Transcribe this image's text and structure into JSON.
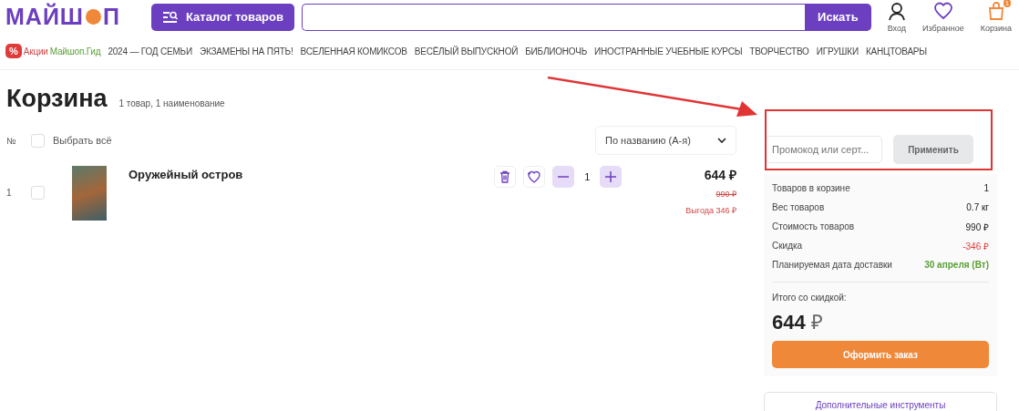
{
  "header": {
    "logo_start": "МАЙШ",
    "logo_end": "П",
    "catalog_button": "Каталог товаров",
    "search_button": "Искать",
    "actions": [
      {
        "kind": "user",
        "label": "Вход"
      },
      {
        "kind": "heart",
        "label": "Избранное"
      },
      {
        "kind": "cart",
        "label": "Корзина",
        "badge": "1"
      }
    ]
  },
  "nav": {
    "promo_icon": "%",
    "items": [
      {
        "kind": "sale",
        "label": "Акции"
      },
      {
        "kind": "guide",
        "label": "Майшоп.Гид"
      },
      {
        "kind": "plain",
        "label": "2024 — ГОД СЕМЬИ"
      },
      {
        "kind": "plain",
        "label": "ЭКЗАМЕНЫ НА ПЯТЬ!"
      },
      {
        "kind": "plain",
        "label": "ВСЕЛЕННАЯ КОМИКСОВ"
      },
      {
        "kind": "plain",
        "label": "ВЕСЁЛЫЙ ВЫПУСКНОЙ"
      },
      {
        "kind": "plain",
        "label": "БИБЛИОНОЧЬ"
      },
      {
        "kind": "plain",
        "label": "ИНОСТРАННЫЕ УЧЕБНЫЕ КУРСЫ"
      },
      {
        "kind": "plain",
        "label": "ТВОРЧЕСТВО"
      },
      {
        "kind": "plain",
        "label": "ИГРУШКИ"
      },
      {
        "kind": "plain",
        "label": "КАНЦТОВАРЫ"
      }
    ]
  },
  "cart": {
    "title": "Корзина",
    "subtitle": "1 товар, 1 наименование",
    "number_header": "№",
    "select_all": {
      "label": "Выбрать всё",
      "checked": false
    },
    "sort": "По названию (А-я)",
    "items": [
      {
        "index": "1",
        "checked": false,
        "title": "Оружейный остров",
        "quantity": "1",
        "price": "644 ₽",
        "old_price": "990 ₽",
        "savings": "Выгода 346 ₽"
      }
    ]
  },
  "promo": {
    "placeholder": "Промокод или серт...",
    "apply_button": "Применить"
  },
  "summary": {
    "rows": [
      {
        "kind": "plain",
        "label": "Товаров в корзине",
        "value": "1"
      },
      {
        "kind": "plain",
        "label": "Вес товаров",
        "value": "0.7 кг"
      },
      {
        "kind": "plain",
        "label": "Стоимость товаров",
        "value": "990 ₽"
      },
      {
        "kind": "discount",
        "label": "Скидка",
        "value": "-346 ₽"
      },
      {
        "kind": "delivery",
        "label": "Планируемая дата доставки",
        "value": "30 апреля (Вт)"
      }
    ],
    "total_label": "Итого со скидкой:",
    "total_amount": "644",
    "total_currency": "₽",
    "checkout_button": "Оформить заказ"
  },
  "tools_button": "Дополнительные инструменты",
  "annotations": {
    "arrow": true,
    "highlight_frame": true
  }
}
